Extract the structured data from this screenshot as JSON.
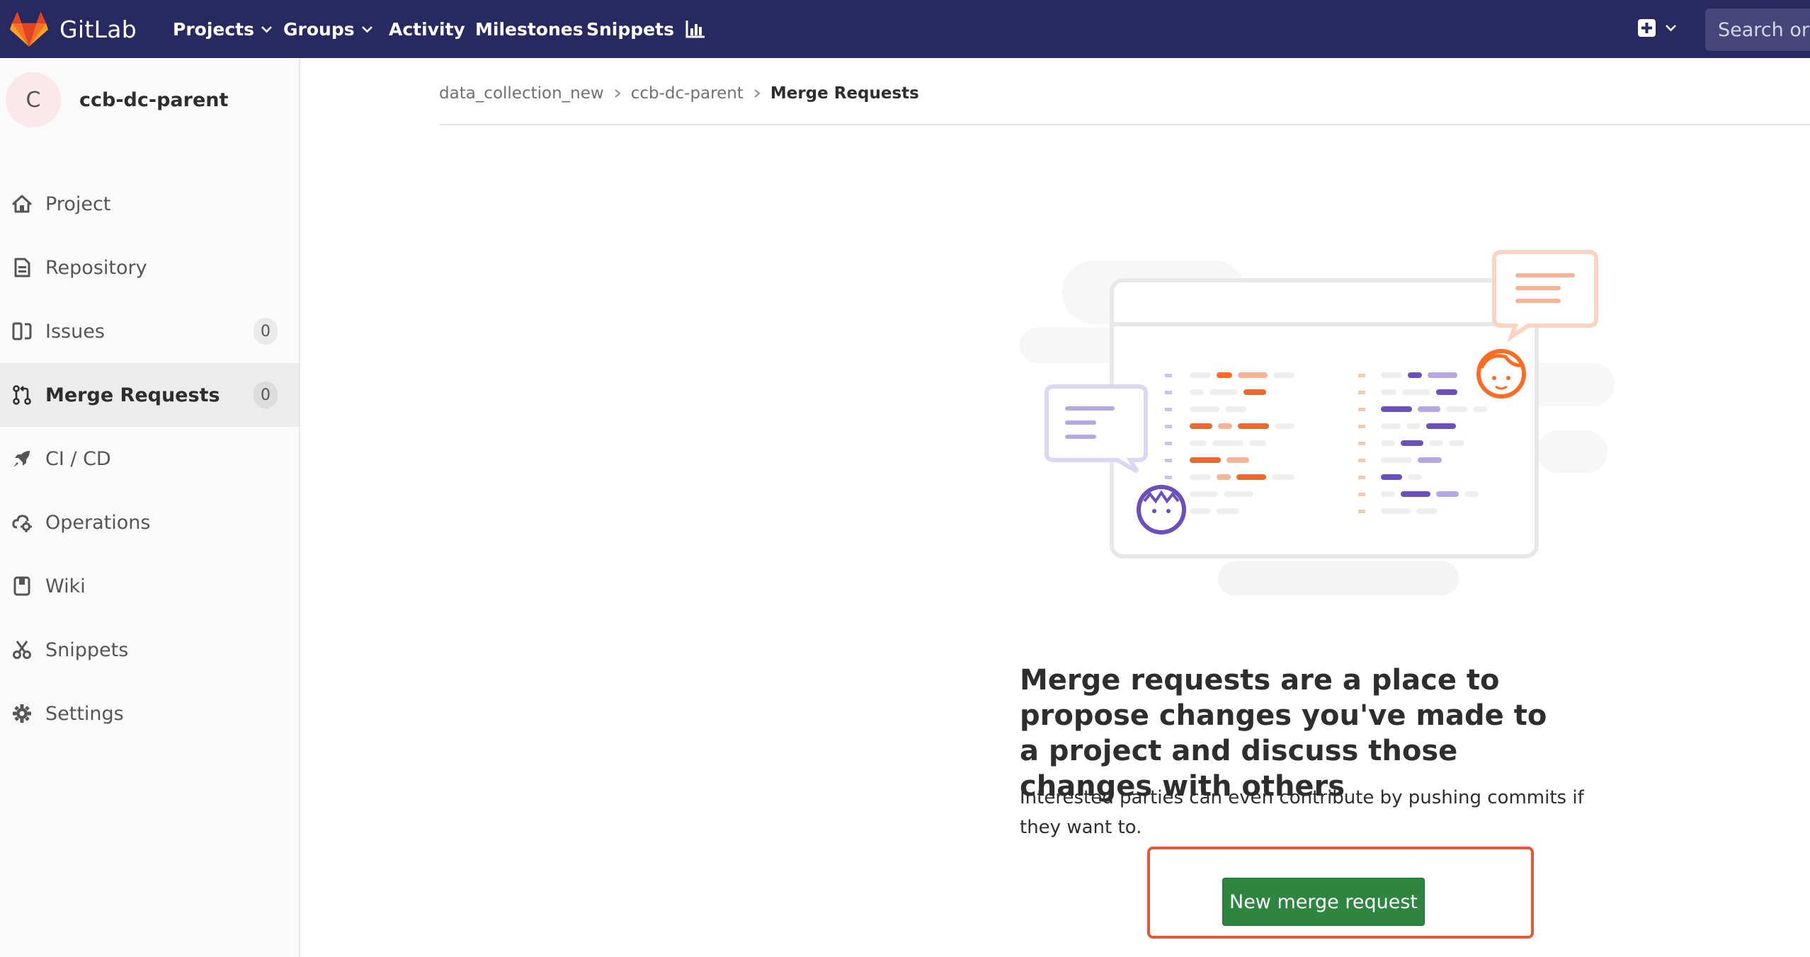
{
  "navbar": {
    "brand": "GitLab",
    "items": [
      {
        "label": "Projects",
        "dropdown": true
      },
      {
        "label": "Groups",
        "dropdown": true
      },
      {
        "label": "Activity"
      },
      {
        "label": "Milestones"
      },
      {
        "label": "Snippets"
      }
    ],
    "extra_icon": "chart-icon",
    "new_icon": "plus-square-icon",
    "search_placeholder": "Search or j",
    "background": "#292961"
  },
  "sidebar": {
    "avatar_letter": "C",
    "project_name": "ccb-dc-parent",
    "items": [
      {
        "label": "Project",
        "icon": "home-icon"
      },
      {
        "label": "Repository",
        "icon": "document-icon"
      },
      {
        "label": "Issues",
        "icon": "issues-icon",
        "count": "0"
      },
      {
        "label": "Merge Requests",
        "icon": "merge-request-icon",
        "count": "0",
        "active": true
      },
      {
        "label": "CI / CD",
        "icon": "rocket-icon"
      },
      {
        "label": "Operations",
        "icon": "cloud-gear-icon"
      },
      {
        "label": "Wiki",
        "icon": "book-icon"
      },
      {
        "label": "Snippets",
        "icon": "scissors-icon"
      },
      {
        "label": "Settings",
        "icon": "gear-icon"
      }
    ]
  },
  "breadcrumb": [
    "data_collection_new",
    "ccb-dc-parent",
    "Merge Requests"
  ],
  "empty_state": {
    "title": "Merge requests are a place to propose changes you've made to a project and discuss those changes with others",
    "description": "Interested parties can even contribute by pushing commits if they want to.",
    "button_label": "New merge request",
    "button_color": "#2e8540",
    "highlight_color": "#e05a33"
  }
}
